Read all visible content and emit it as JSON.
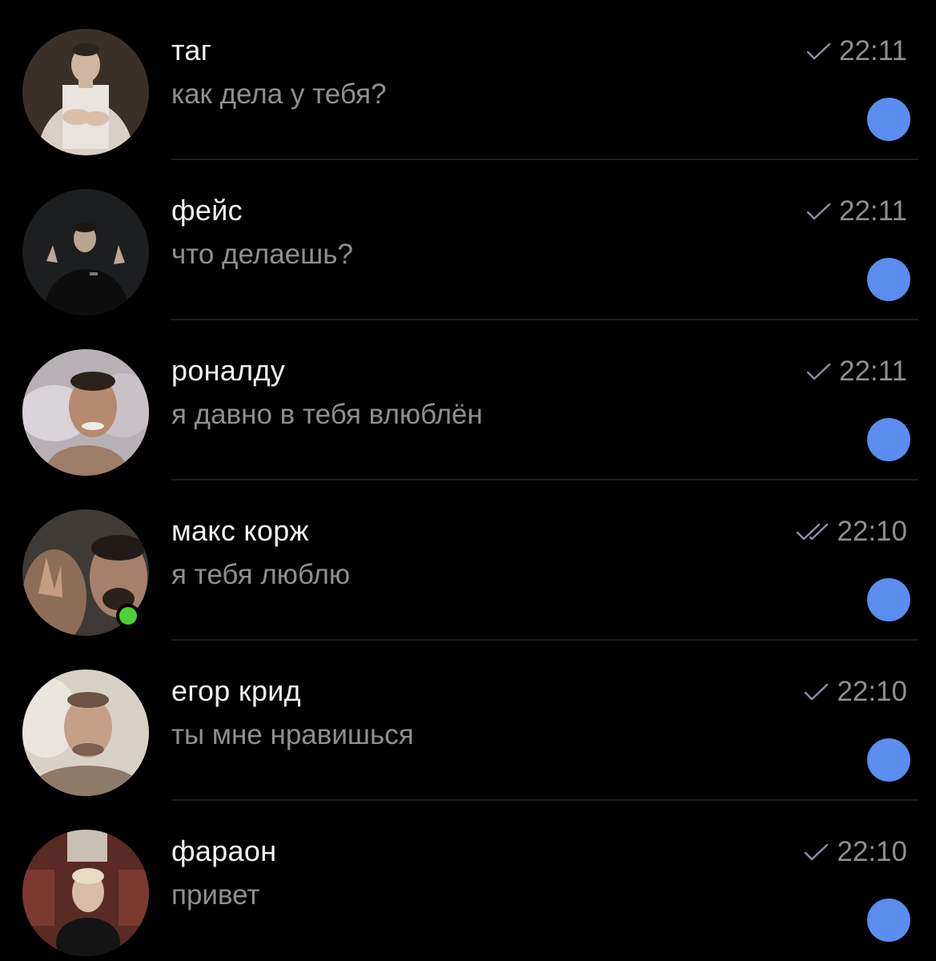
{
  "colors": {
    "background": "#000000",
    "name_text": "#f2f2f2",
    "secondary_text": "#8e8e93",
    "check_color": "#8e8ea8",
    "unread_dot": "#5b8def",
    "online_dot": "#4cd137"
  },
  "chats": [
    {
      "name": "таг",
      "message": "как дела у тебя?",
      "time": "22:11",
      "status_icon": "single-check-icon",
      "unread": true,
      "online": false
    },
    {
      "name": "фейс",
      "message": "что делаешь?",
      "time": "22:11",
      "status_icon": "single-check-icon",
      "unread": true,
      "online": false
    },
    {
      "name": "роналду",
      "message": "я давно в тебя влюблён",
      "time": "22:11",
      "status_icon": "single-check-icon",
      "unread": true,
      "online": false
    },
    {
      "name": "макс корж",
      "message": "я тебя люблю",
      "time": "22:10",
      "status_icon": "double-check-icon",
      "unread": true,
      "online": true
    },
    {
      "name": "егор крид",
      "message": "ты мне нравишься",
      "time": "22:10",
      "status_icon": "single-check-icon",
      "unread": true,
      "online": false
    },
    {
      "name": "фараон",
      "message": "привет",
      "time": "22:10",
      "status_icon": "single-check-icon",
      "unread": true,
      "online": false
    }
  ]
}
